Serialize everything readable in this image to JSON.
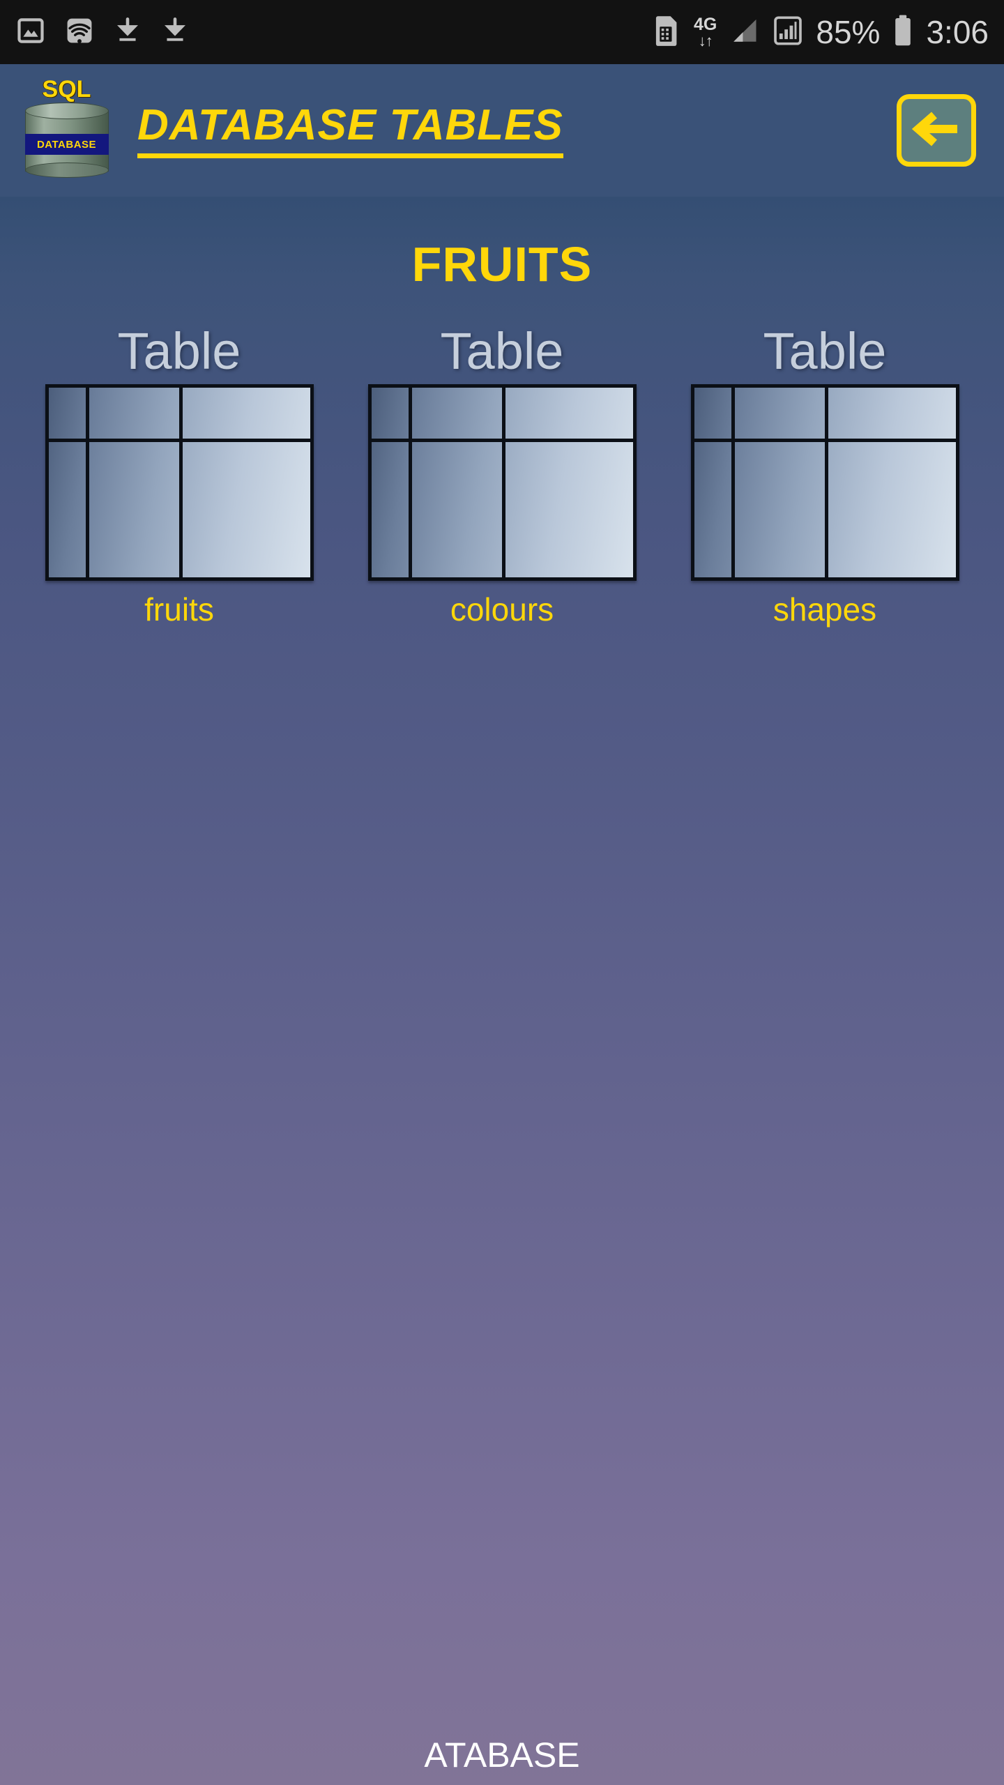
{
  "status_bar": {
    "icons_left": [
      "image-icon",
      "wifi-icon",
      "download-icon",
      "download-icon"
    ],
    "sim_icon": "sim-card-icon",
    "network_type": "4G",
    "network_arrows": "↓↑",
    "signal_icon": "signal-bars-icon",
    "signal_boxed_icon": "signal-boxed-icon",
    "battery_percent": "85%",
    "battery_icon": "battery-icon",
    "clock": "3:06"
  },
  "app_bar": {
    "logo": {
      "top_label": "SQL",
      "band_label": "DATABASE",
      "icon_name": "sql-database-cylinder-icon"
    },
    "title": "DATABASE TABLES",
    "back_button": {
      "icon_name": "back-arrow-icon",
      "label": ""
    }
  },
  "content": {
    "page_title": "FRUITS",
    "tables": [
      {
        "caption": "Table",
        "name": "fruits"
      },
      {
        "caption": "Table",
        "name": "colours"
      },
      {
        "caption": "Table",
        "name": "shapes"
      }
    ],
    "bottom_text": "ATABASE"
  },
  "colors": {
    "status_bar_bg": "#121212",
    "app_bar_bg": "#3a5278",
    "accent_yellow": "#ffd70a",
    "content_top": "#344e73",
    "content_bottom": "#817497",
    "table_border": "#0b0f16",
    "table_caption": "#c6cfdc",
    "logo_band": "#13177e",
    "back_button_fill": "#5d7f7e"
  }
}
